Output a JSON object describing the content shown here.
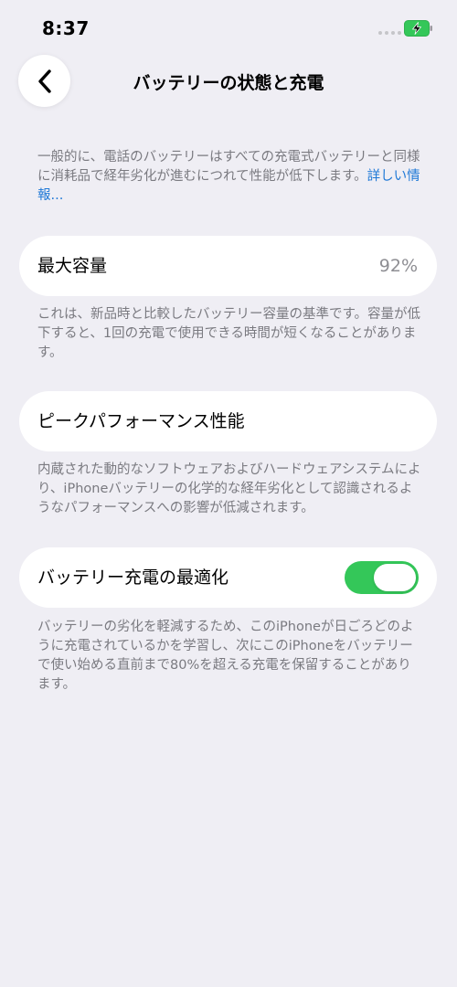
{
  "status_bar": {
    "time": "8:37",
    "battery_state": "charging",
    "battery_color": "#34c759"
  },
  "header": {
    "title": "バッテリーの状態と充電",
    "back_icon": "chevron-left-icon"
  },
  "intro": {
    "text": "一般的に、電話のバッテリーはすべての充電式バッテリーと同様に消耗品で経年劣化が進むにつれて性能が低下します。",
    "link_label": "詳しい情報..."
  },
  "maximum_capacity": {
    "label": "最大容量",
    "value": "92%",
    "description": "これは、新品時と比較したバッテリー容量の基準です。容量が低下すると、1回の充電で使用できる時間が短くなることがあります。"
  },
  "peak_performance": {
    "label": "ピークパフォーマンス性能",
    "description": "内蔵された動的なソフトウェアおよびハードウェアシステムにより、iPhoneバッテリーの化学的な経年劣化として認識されるようなパフォーマンスへの影響が低減されます。"
  },
  "optimized_charging": {
    "label": "バッテリー充電の最適化",
    "enabled": true,
    "toggle_color": "#34c759",
    "description": "バッテリーの劣化を軽減するため、このiPhoneが日ごろどのように充電されているかを学習し、次にこのiPhoneをバッテリーで使い始める直前まで80%を超える充電を保留することがあります。"
  }
}
